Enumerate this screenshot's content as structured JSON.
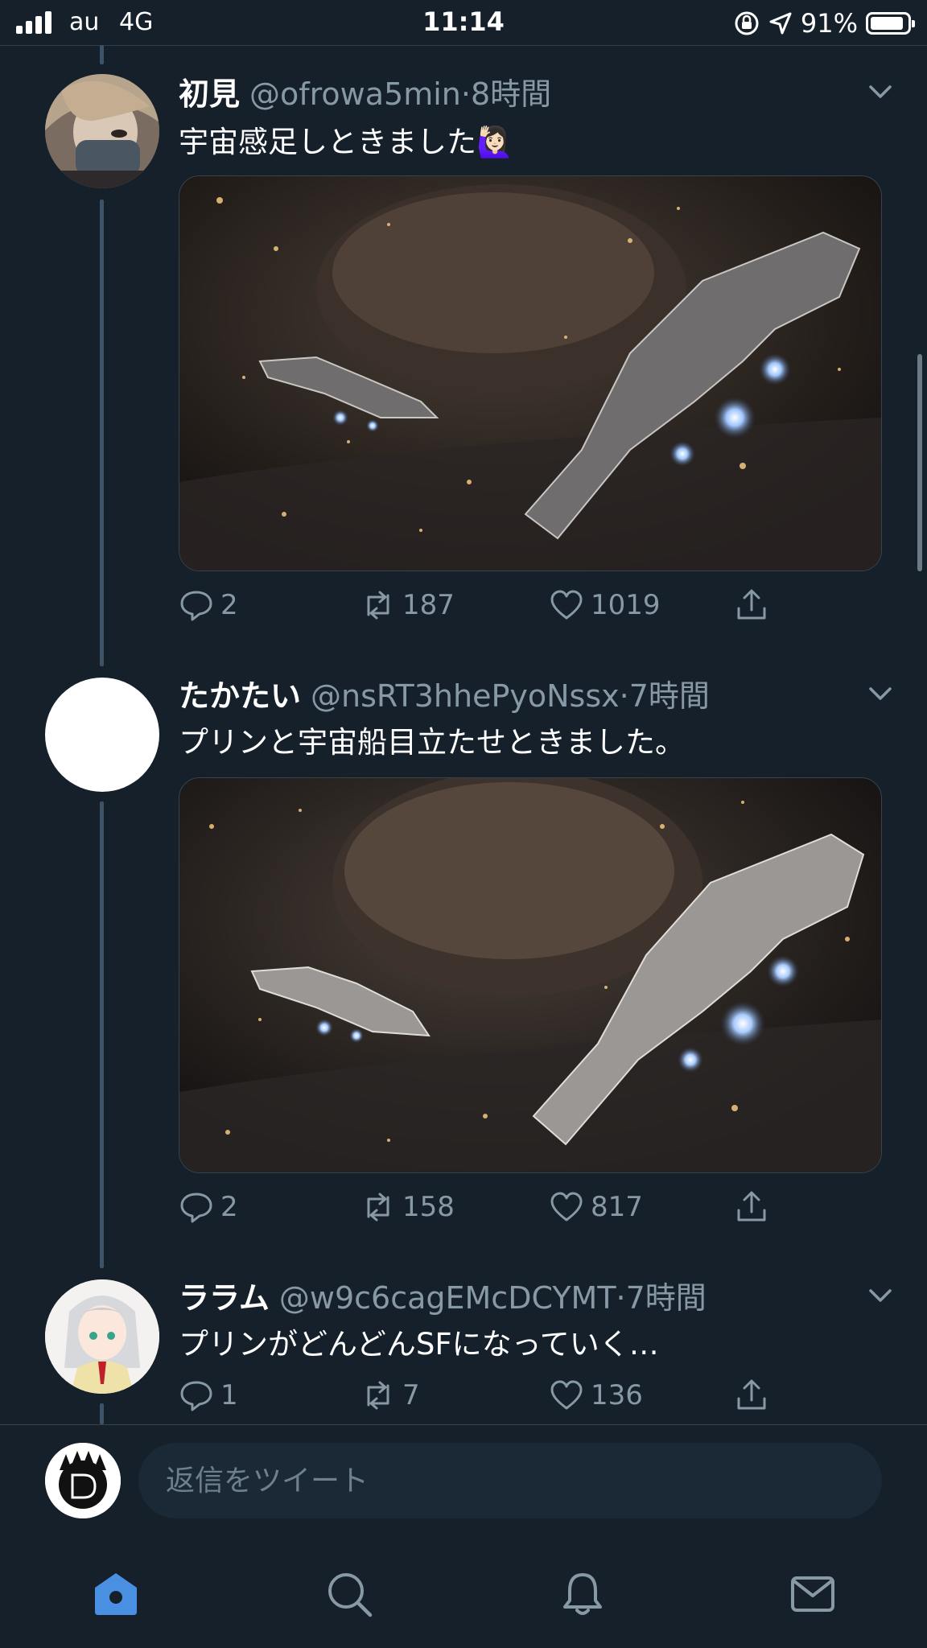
{
  "status_bar": {
    "carrier": "au",
    "network": "4G",
    "time": "11:14",
    "battery_percent_label": "91%",
    "battery_level": 0.91,
    "icons": [
      "signal-icon",
      "rotation-lock-icon",
      "location-arrow-icon",
      "battery-icon"
    ]
  },
  "tweets": [
    {
      "name": "初見",
      "handle": "@ofrowa5min",
      "separator": "·",
      "time": "8時間",
      "text": "宇宙感足しときました🙋🏻‍♀️",
      "has_media": true,
      "media_icon": "spaceship-image",
      "replies": "2",
      "retweets": "187",
      "likes": "1019"
    },
    {
      "name": "たかたい",
      "handle": "@nsRT3hhePyoNssx",
      "separator": "·",
      "time": "7時間",
      "text": "プリンと宇宙船目立たせときました。",
      "has_media": true,
      "media_icon": "spaceship-image",
      "replies": "2",
      "retweets": "158",
      "likes": "817"
    },
    {
      "name": "ララム",
      "handle": "@w9c6cagEMcDCYMT",
      "separator": "·",
      "time": "7時間",
      "text": "プリンがどんどんSFになっていく…",
      "has_media": false,
      "replies": "1",
      "retweets": "7",
      "likes": "136"
    }
  ],
  "reply": {
    "placeholder": "返信をツイート",
    "value": ""
  },
  "tab_bar": {
    "tabs": [
      {
        "icon": "home-icon",
        "active": true
      },
      {
        "icon": "search-icon",
        "active": false
      },
      {
        "icon": "bell-icon",
        "active": false
      },
      {
        "icon": "mail-icon",
        "active": false
      }
    ]
  },
  "colors": {
    "background": "#15202b",
    "accent": "#1da1f2",
    "muted_text": "#8899a6",
    "active_tab": "#4a90e2"
  }
}
